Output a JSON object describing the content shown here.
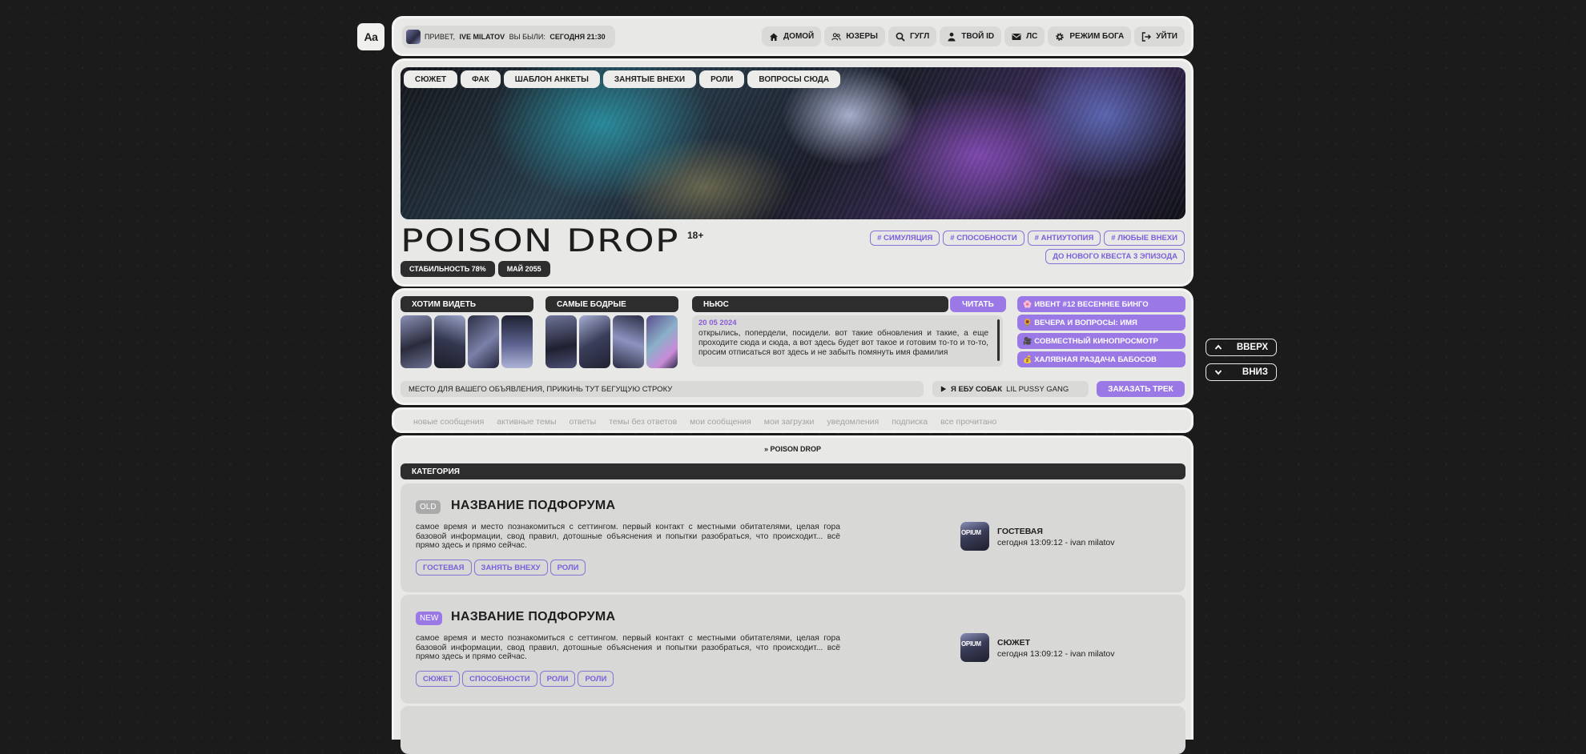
{
  "font_toggle": "Aa",
  "topbar": {
    "greeting_prefix": "ПРИВЕТ,",
    "user": "IVE MILATOV",
    "last_visit_prefix": "ВЫ БЫЛИ:",
    "last_visit": "СЕГОДНЯ 21:30",
    "nav": [
      {
        "label": "ДОМОЙ",
        "icon": "home-icon"
      },
      {
        "label": "ЮЗЕРЫ",
        "icon": "users-icon"
      },
      {
        "label": "ГУГЛ",
        "icon": "search-icon"
      },
      {
        "label": "ТВОЙ ID",
        "icon": "user-icon"
      },
      {
        "label": "ЛС",
        "icon": "mail-icon"
      },
      {
        "label": "РЕЖИМ БОГА",
        "icon": "gear-icon"
      },
      {
        "label": "УЙТИ",
        "icon": "logout-icon"
      }
    ]
  },
  "hero": {
    "tabs": [
      "СЮЖЕТ",
      "ФАК",
      "ШАБЛОН АНКЕТЫ",
      "ЗАНЯТЫЕ ВНЕХИ",
      "РОЛИ",
      "ВОПРОСЫ СЮДА"
    ],
    "title": "POISON DROP",
    "age": "18+",
    "stability": "СТАБИЛЬНОСТЬ 78%",
    "date": "МАЙ 2055",
    "tags": [
      "# СИМУЛЯЦИЯ",
      "# СПОСОБНОСТИ",
      "# АНТИУТОПИЯ",
      "# ЛЮБЫЕ ВНЕХИ",
      "ДО НОВОГО КВЕСТА 3 ЭПИЗОДА"
    ]
  },
  "widgets": {
    "wanted_title": "ХОТИМ ВИДЕТЬ",
    "active_title": "САМЫЕ БОДРЫЕ",
    "news_title": "НЬЮС",
    "read_label": "ЧИТАТЬ",
    "news_date": "20 05 2024",
    "news_text": "открылись, попердели, посидели. вот такие обновления и такие, а еще проходите сюда и сюда, а вот здесь будет вот такое и готовим то-то и то-то, просим отписаться вот здесь и не забыть помянуть имя фамилия",
    "events": [
      {
        "emoji": "🌸",
        "label": "ИВЕНТ #12 ВЕСЕННЕЕ БИНГО"
      },
      {
        "emoji": "🌻",
        "label": "ВЕЧЕРА И ВОПРОСЫ: ИМЯ"
      },
      {
        "emoji": "🎥",
        "label": "СОВМЕСТНЫЙ КИНОПРОСМОТР"
      },
      {
        "emoji": "💰",
        "label": "ХАЛЯВНАЯ РАЗДАЧА БАБОСОВ"
      }
    ],
    "ad_text": "МЕСТО ДЛЯ ВАШЕГО ОБЪЯВЛЕНИЯ, ПРИКИНЬ ТУТ БЕГУЩУЮ СТРОКУ",
    "track_title": "Я ЕБУ СОБАК",
    "track_artist": "LIL PUSSY GANG",
    "order_label": "ЗАКАЗАТЬ ТРЕК"
  },
  "quicklinks": [
    "новые сообщения",
    "активные темы",
    "ответы",
    "темы без ответов",
    "мои сообщения",
    "мои загрузки",
    "уведомления",
    "подписка",
    "все прочитано"
  ],
  "forum": {
    "breadcrumb": "» POISON DROP",
    "category": "КАТЕГОРИЯ",
    "subforums": [
      {
        "badge": "OLD",
        "name": "НАЗВАНИЕ ПОДФОРУМА",
        "desc": "самое время и место познакомиться с сеттингом. первый контакт с местными обитателями, целая гора базовой информации, свод правил, дотошные объяснения и попытки разобраться, что происходит... всё прямо здесь и прямо сейчас.",
        "tags": [
          "ГОСТЕВАЯ",
          "ЗАНЯТЬ ВНЕХУ",
          "РОЛИ"
        ],
        "last_topic": "ГОСТЕВАЯ",
        "last_meta": "сегодня 13:09:12 - ivan milatov"
      },
      {
        "badge": "NEW",
        "name": "НАЗВАНИЕ ПОДФОРУМА",
        "desc": "самое время и место познакомиться с сеттингом. первый контакт с местными обитателями, целая гора базовой информации, свод правил, дотошные объяснения и попытки разобраться, что происходит... всё прямо здесь и прямо сейчас.",
        "tags": [
          "СЮЖЕТ",
          "СПОСОБНОСТИ",
          "РОЛИ",
          "РОЛИ"
        ],
        "last_topic": "СЮЖЕТ",
        "last_meta": "сегодня 13:09:12 - ivan milatov"
      }
    ]
  },
  "side": {
    "up": "ВВЕРХ",
    "down": "ВНИЗ"
  },
  "colors": {
    "accent": "#9a78e6",
    "dark": "#2d2d2d",
    "panel": "#e8e8e6",
    "badge_old": "#a9a9a9"
  }
}
